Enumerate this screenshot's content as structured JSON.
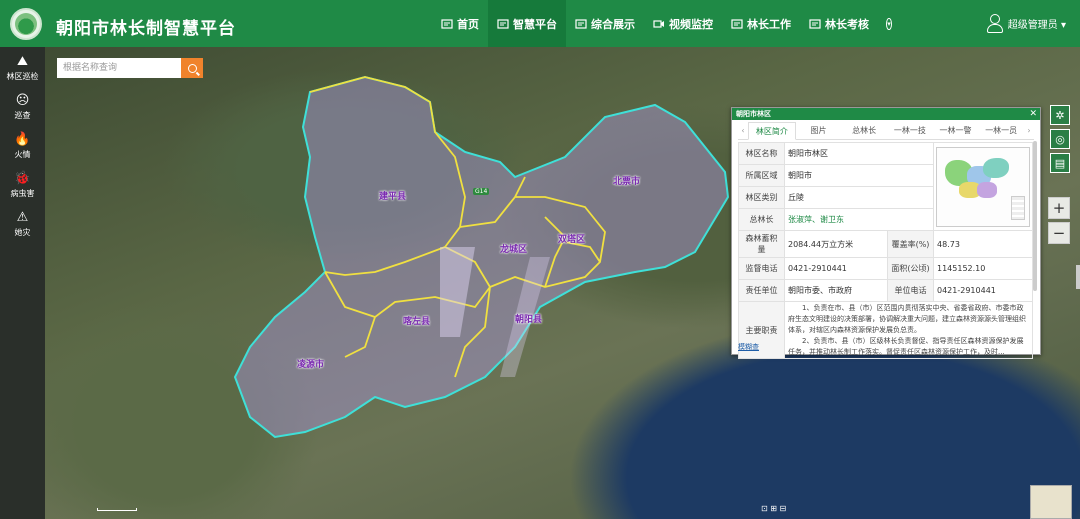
{
  "header": {
    "title": "朝阳市林长制智慧平台",
    "nav": [
      {
        "label": "首页",
        "icon": "home-icon"
      },
      {
        "label": "智慧平台",
        "icon": "platform-icon"
      },
      {
        "label": "综合展示",
        "icon": "display-icon"
      },
      {
        "label": "视频监控",
        "icon": "camera-icon"
      },
      {
        "label": "林长工作",
        "icon": "work-icon"
      },
      {
        "label": "林长考核",
        "icon": "assess-icon"
      }
    ],
    "user_name": "超级管理员 ▾"
  },
  "sidebar": {
    "items": [
      {
        "label": "林区巡检",
        "icon": "inspection-icon",
        "glyph": "⛰"
      },
      {
        "label": "巡查",
        "icon": "patrol-icon",
        "glyph": "☹"
      },
      {
        "label": "火情",
        "icon": "fire-icon",
        "glyph": "🔥"
      },
      {
        "label": "病虫害",
        "icon": "pest-icon",
        "glyph": "🐞"
      },
      {
        "label": "她灾",
        "icon": "disaster-icon",
        "glyph": "⚠"
      }
    ]
  },
  "search": {
    "placeholder": "根据名称查询"
  },
  "map": {
    "regions": [
      {
        "name": "建平县"
      },
      {
        "name": "北票市"
      },
      {
        "name": "龙城区"
      },
      {
        "name": "双塔区"
      },
      {
        "name": "喀左县"
      },
      {
        "name": "朝阳县"
      },
      {
        "name": "凌源市"
      }
    ],
    "highway_badge": "G14"
  },
  "panel": {
    "title": "朝阳市林区",
    "tabs": [
      "林区简介",
      "图片",
      "总林长",
      "一林一技",
      "一林一警",
      "一林一员"
    ],
    "active_tab": "林区简介",
    "rows": {
      "name_label": "林区名称",
      "name_value": "朝阳市林区",
      "region_label": "所属区域",
      "region_value": "朝阳市",
      "type_label": "林区类别",
      "type_value": "丘陵",
      "chief_label": "总林长",
      "chief_value": "张淑萍、谢卫东",
      "volume_label": "森林蓄积量",
      "volume_value": "2084.44万立方米",
      "coverage_label": "覆盖率(%)",
      "coverage_value": "48.73",
      "phone_label": "监督电话",
      "phone_value": "0421-2910441",
      "area_label": "面积(公顷)",
      "area_value": "1145152.10",
      "unit_label": "责任单位",
      "unit_value": "朝阳市委、市政府",
      "unit_phone_label": "单位电话",
      "unit_phone_value": "0421-2910441",
      "duty_label": "主要职责",
      "duty_text_1": "1、负责在市、县（市）区范围内贯彻落实中央、省委省政府、市委市政府生态文明建设的决策部署，协调解决重大问题，建立森林资源源头管理组织体系，对辖区内森林资源保护发展负总责。",
      "duty_text_2": "2、负责市、县（市）区级林长负责督促、指导责任区森林资源保护发展任务，并推动林长制工作落实。督促责任区森林资源保护工作，及时..."
    },
    "footnote": "模糊查"
  },
  "bottom_text": "⊡ ⊞ ⊟"
}
